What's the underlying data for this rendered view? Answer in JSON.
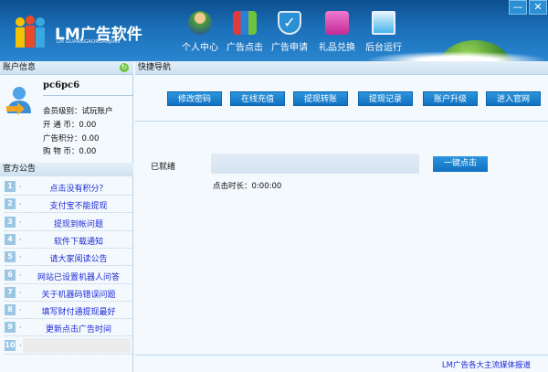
{
  "app": {
    "title": "LM广告软件",
    "subtitle": "LM GUANGGAORUANJIAN"
  },
  "window": {
    "minimize": "—",
    "close": "✕"
  },
  "nav": [
    {
      "label": "个人中心",
      "icon": "users-icon",
      "color": "#4a9a3a"
    },
    {
      "label": "广告点击",
      "icon": "bar-chart-icon",
      "color": "#e23a3a"
    },
    {
      "label": "广告申请",
      "icon": "shield-check-icon",
      "color": "#2b8fd6"
    },
    {
      "label": "礼品兑换",
      "icon": "shopping-bag-icon",
      "color": "#e54fb7"
    },
    {
      "label": "后台运行",
      "icon": "monitor-icon",
      "color": "#7fd0f5"
    }
  ],
  "account": {
    "header": "账户信息",
    "username": "pc6pc6",
    "fields": [
      {
        "label": "会员级别：",
        "value": "试玩账户"
      },
      {
        "label": "开 通 币：",
        "value": "0.00"
      },
      {
        "label": "广告积分：",
        "value": "0.00"
      },
      {
        "label": "购 物 币：",
        "value": "0.00"
      }
    ]
  },
  "notices": {
    "header": "官方公告",
    "items": [
      {
        "num": "1",
        "text": "点击没有积分？"
      },
      {
        "num": "2",
        "text": "支付宝不能提现"
      },
      {
        "num": "3",
        "text": "提现到帐问题"
      },
      {
        "num": "4",
        "text": "软件下载通知"
      },
      {
        "num": "5",
        "text": "请大家阅读公告"
      },
      {
        "num": "6",
        "text": "网站已设置机器人问答"
      },
      {
        "num": "7",
        "text": "关于机器码错误问题"
      },
      {
        "num": "8",
        "text": "填写财付通提现最好"
      },
      {
        "num": "9",
        "text": "更新点击广告时间"
      },
      {
        "num": "10",
        "text": ""
      }
    ]
  },
  "quicknav": {
    "header": "快捷导航",
    "buttons": [
      "修改密码",
      "在线充值",
      "提现转账",
      "提现记录",
      "账户升级",
      "进入官网"
    ]
  },
  "main": {
    "status": "已就绪",
    "progress": 0,
    "click_button": "一键点击",
    "duration_label": "点击时长：",
    "duration": "0:00:00"
  },
  "footer": {
    "link": "LM广告各大主流媒体报道"
  }
}
